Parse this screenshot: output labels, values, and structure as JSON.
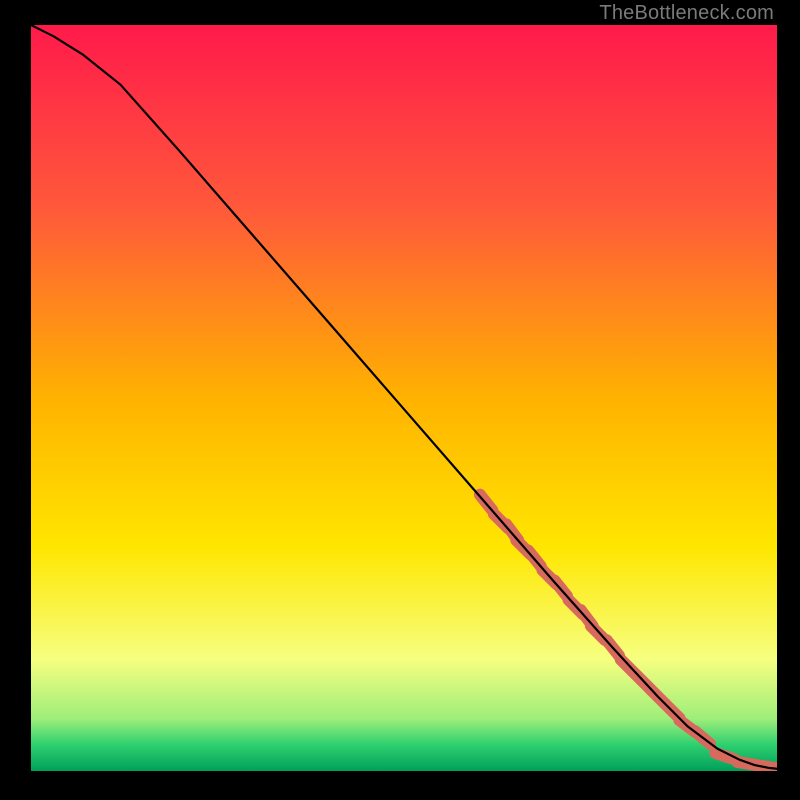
{
  "attribution": "TheBottleneck.com",
  "chart_data": {
    "type": "line",
    "title": "",
    "xlabel": "",
    "ylabel": "",
    "xlim": [
      0,
      100
    ],
    "ylim": [
      0,
      100
    ],
    "gradient_stops": [
      {
        "offset": 0,
        "color": "#ff1a4b"
      },
      {
        "offset": 0.25,
        "color": "#ff5a3a"
      },
      {
        "offset": 0.5,
        "color": "#ffb200"
      },
      {
        "offset": 0.7,
        "color": "#ffe600"
      },
      {
        "offset": 0.85,
        "color": "#f6ff80"
      },
      {
        "offset": 0.93,
        "color": "#9eee7a"
      },
      {
        "offset": 0.965,
        "color": "#2ecf6f"
      },
      {
        "offset": 1.0,
        "color": "#00a05a"
      }
    ],
    "series": [
      {
        "name": "bottleneck-curve",
        "x": [
          0,
          3,
          7,
          12,
          20,
          30,
          40,
          50,
          60,
          70,
          78,
          84,
          88,
          92,
          95,
          97,
          99,
          100
        ],
        "y": [
          100,
          98.5,
          96,
          92,
          83,
          71.5,
          60,
          48.5,
          37,
          25.5,
          16.5,
          10,
          6,
          3,
          1.5,
          0.8,
          0.4,
          0.3
        ]
      }
    ],
    "data_points": {
      "name": "highlighted-range",
      "color": "#d86a5d",
      "x": [
        61,
        63,
        64.5,
        66,
        67.5,
        69.5,
        71,
        73,
        74.5,
        76,
        78,
        80,
        82,
        84,
        86,
        88,
        90,
        93,
        96,
        99
      ],
      "y": [
        36,
        33.5,
        32,
        30,
        28.5,
        26,
        24.5,
        22,
        20.5,
        18.5,
        16.5,
        14,
        12,
        10,
        8,
        6,
        4.5,
        2,
        1,
        0.5
      ]
    }
  }
}
